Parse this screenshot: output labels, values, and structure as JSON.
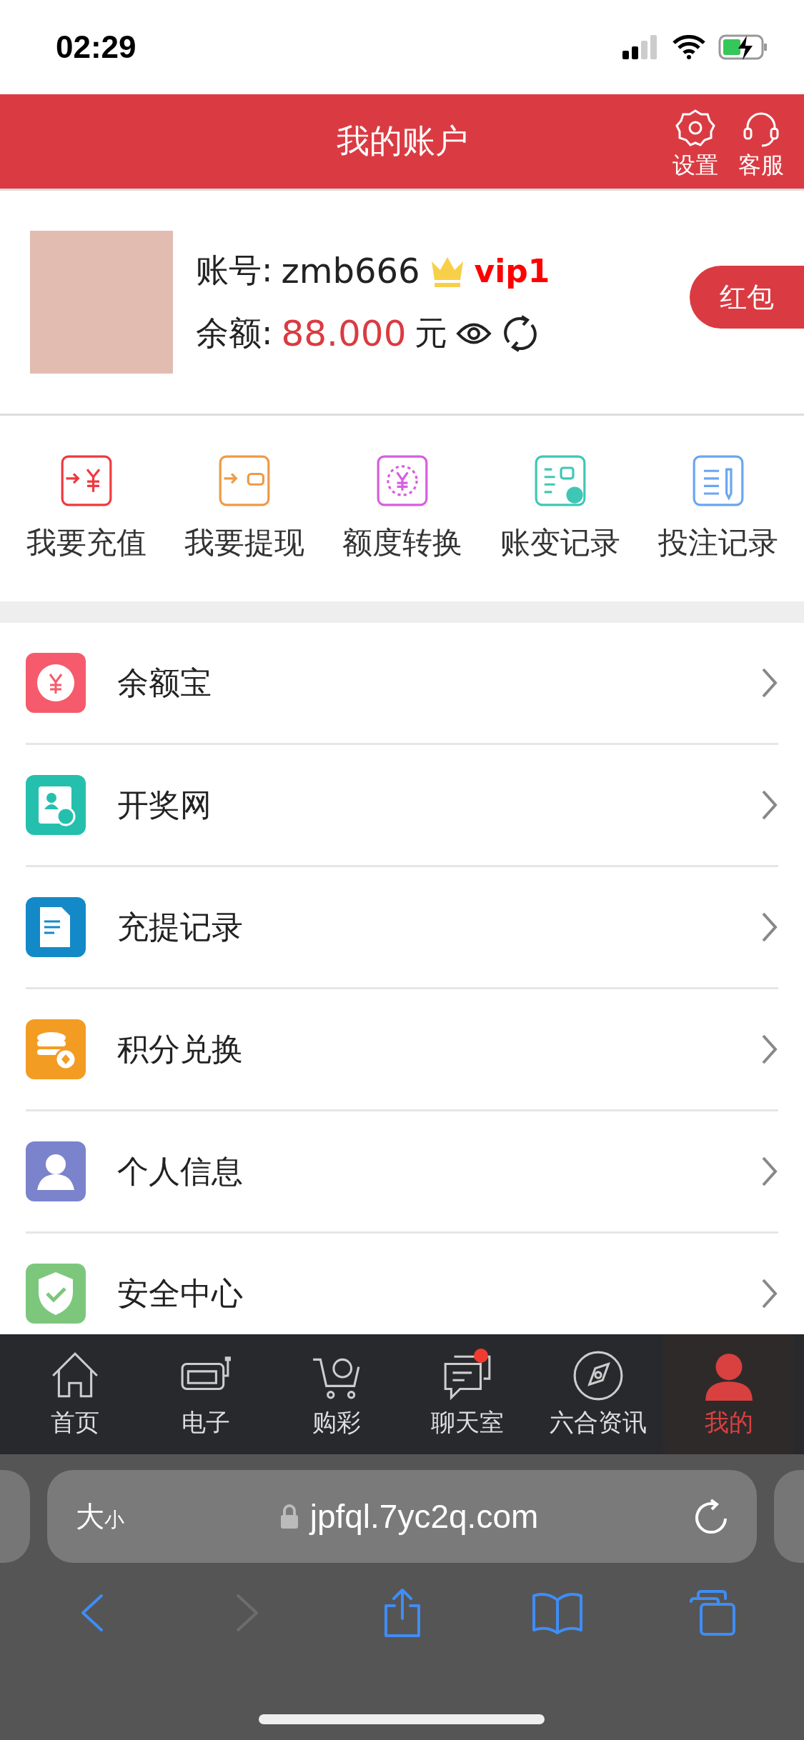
{
  "status_bar": {
    "time": "02:29"
  },
  "header": {
    "title": "我的账户",
    "actions": [
      {
        "kind": "settings",
        "label": "设置"
      },
      {
        "kind": "support",
        "label": "客服"
      }
    ]
  },
  "profile": {
    "account_label": "账号:",
    "username": "zmb666",
    "vip": "vip1",
    "balance_label": "余额:",
    "balance": "88.000",
    "unit": "元",
    "red_packet": "红包"
  },
  "quick_actions": [
    {
      "kind": "deposit",
      "label": "我要充值",
      "color": "#f0393d"
    },
    {
      "kind": "withdraw",
      "label": "我要提现",
      "color": "#ef9a44"
    },
    {
      "kind": "transfer",
      "label": "额度转换",
      "color": "#d65ee0"
    },
    {
      "kind": "ledger",
      "label": "账变记录",
      "color": "#3fc7b6"
    },
    {
      "kind": "bets",
      "label": "投注记录",
      "color": "#6aa6f2"
    }
  ],
  "menu": [
    {
      "kind": "coin",
      "label": "余额宝",
      "color": "#f55b6c"
    },
    {
      "kind": "profile-card",
      "label": "开奖网",
      "color": "#25c0ad"
    },
    {
      "kind": "document",
      "label": "充提记录",
      "color": "#1489c8"
    },
    {
      "kind": "database",
      "label": "积分兑换",
      "color": "#f29c23"
    },
    {
      "kind": "person",
      "label": "个人信息",
      "color": "#7a83cb"
    },
    {
      "kind": "shield",
      "label": "安全中心",
      "color": "#7dc77d"
    }
  ],
  "tab_bar": [
    {
      "kind": "home",
      "label": "首页",
      "selected": false,
      "badge": false
    },
    {
      "kind": "slots",
      "label": "电子",
      "selected": false,
      "badge": false
    },
    {
      "kind": "cart",
      "label": "购彩",
      "selected": false,
      "badge": false
    },
    {
      "kind": "chat",
      "label": "聊天室",
      "selected": false,
      "badge": true
    },
    {
      "kind": "compass",
      "label": "六合资讯",
      "selected": false,
      "badge": false
    },
    {
      "kind": "person",
      "label": "我的",
      "selected": true,
      "badge": false
    }
  ],
  "browser": {
    "text_size_large": "大",
    "text_size_small": "小",
    "url": "jpfql.7yc2q.com",
    "toolbar": [
      {
        "kind": "back",
        "disabled": false
      },
      {
        "kind": "forward",
        "disabled": true
      },
      {
        "kind": "share",
        "disabled": false
      },
      {
        "kind": "bookmarks",
        "disabled": false
      },
      {
        "kind": "tabs",
        "disabled": false
      }
    ]
  }
}
